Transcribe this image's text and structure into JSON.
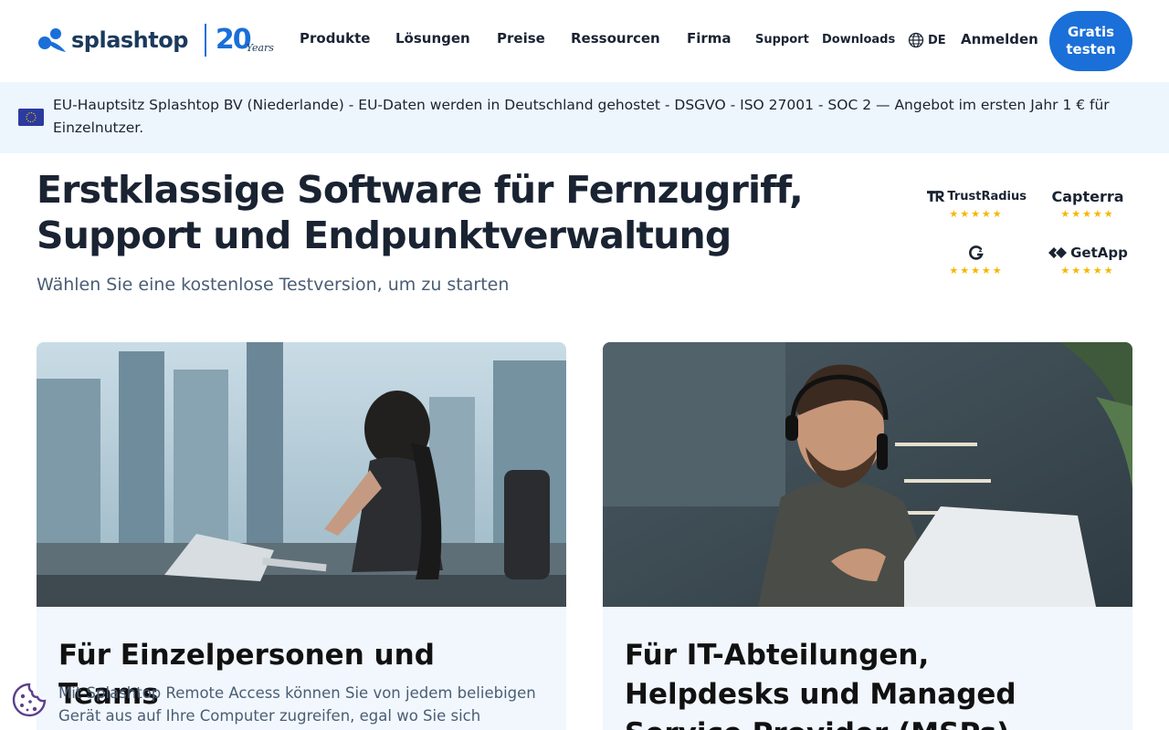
{
  "brand": {
    "name": "splashtop",
    "years_num": "20",
    "years_text": "Years"
  },
  "nav": {
    "items": [
      "Produkte",
      "Lösungen",
      "Preise",
      "Ressourcen",
      "Firma"
    ],
    "support": "Support",
    "downloads": "Downloads",
    "lang": "DE",
    "login": "Anmelden",
    "cta_line1": "Gratis",
    "cta_line2": "testen"
  },
  "banner": {
    "text": "EU-Hauptsitz Splashtop BV (Niederlande) - EU-Daten werden in Deutschland gehostet - DSGVO - ISO 27001 - SOC 2 — Angebot im ersten Jahr 1 € für Einzelnutzer."
  },
  "hero": {
    "title_line1": "Erstklassige Software für Fernzugriff,",
    "title_line2": "Support und Endpunktverwaltung",
    "subtitle": "Wählen Sie eine kostenlose Testversion, um zu starten"
  },
  "reviews": [
    {
      "name": "TrustRadius",
      "stars": "★★★★★"
    },
    {
      "name": "Capterra",
      "stars": "★★★★★"
    },
    {
      "name": "",
      "stars": "★★★★★"
    },
    {
      "name": "GetApp",
      "stars": "★★★★★"
    }
  ],
  "cards": [
    {
      "title": "Für Einzelpersonen und Teams",
      "desc": "Mit Splashtop Remote Access können Sie von jedem beliebigen Gerät aus auf Ihre Computer zugreifen, egal wo Sie sich befinden."
    },
    {
      "title": "Für IT-Abteilungen, Helpdesks und Managed Service Provider (MSPs)",
      "desc": ""
    }
  ],
  "colors": {
    "accent": "#1a6fd8",
    "banner_bg": "#eef6fd",
    "text": "#1a2332",
    "star": "#f5b600"
  }
}
